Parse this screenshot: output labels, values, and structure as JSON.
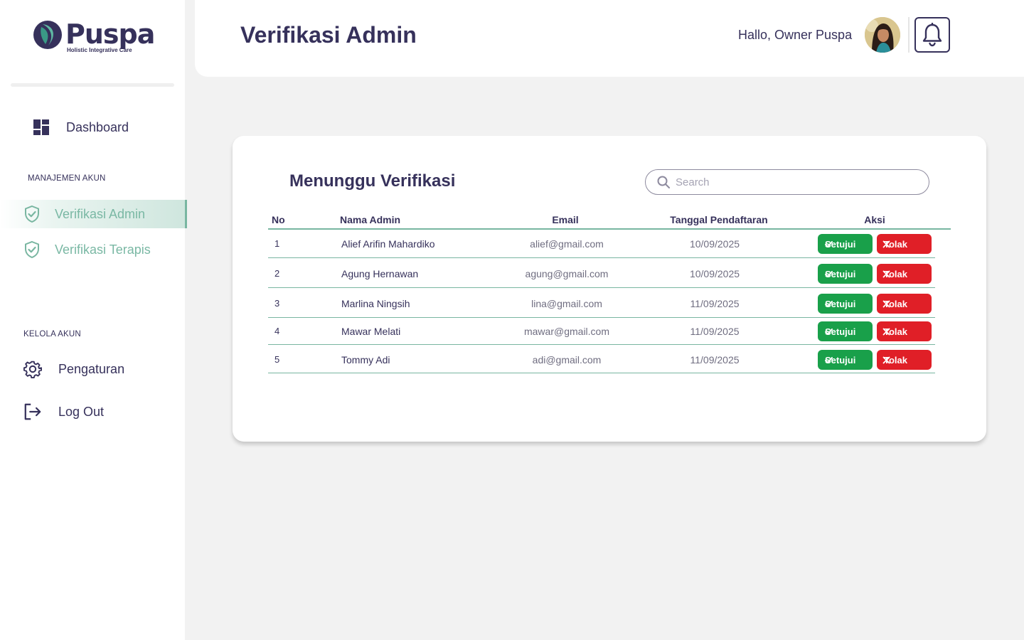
{
  "brand": {
    "name": "Puspa",
    "tagline": "Holistic Integrative Care",
    "primary_color": "#36315b",
    "accent_color": "#79b6a1"
  },
  "sidebar": {
    "dashboard_label": "Dashboard",
    "section_manage": "MANAJEMEN AKUN",
    "verif_admin_label": "Verifikasi Admin",
    "verif_terapis_label": "Verifikasi Terapis",
    "section_account": "KELOLA AKUN",
    "settings_label": "Pengaturan",
    "logout_label": "Log Out",
    "active_item": "Verifikasi Admin"
  },
  "header": {
    "title": "Verifikasi Admin",
    "greeting": "Hallo,  Owner Puspa"
  },
  "card": {
    "title": "Menunggu  Verifikasi",
    "search_placeholder": "Search"
  },
  "table": {
    "columns": [
      "No",
      "Nama  Admin",
      "Email",
      "Tanggal Pendaftaran",
      "Aksi"
    ],
    "approve_label": "Setujui",
    "reject_label": "Tolak",
    "approve_color": "#19a04a",
    "reject_color": "#e01f27",
    "rows": [
      {
        "no": "1",
        "name": "Alief Arifin Mahardiko",
        "email": "alief@gmail.com",
        "date": "10/09/2025"
      },
      {
        "no": "2",
        "name": "Agung Hernawan",
        "email": "agung@gmail.com",
        "date": "10/09/2025"
      },
      {
        "no": "3",
        "name": "Marlina Ningsih",
        "email": "lina@gmail.com",
        "date": "11/09/2025"
      },
      {
        "no": "4",
        "name": "Mawar Melati",
        "email": "mawar@gmail.com",
        "date": "11/09/2025"
      },
      {
        "no": "5",
        "name": "Tommy Adi",
        "email": "adi@gmail.com",
        "date": "11/09/2025"
      }
    ]
  },
  "icons": [
    "puspa-logo-icon",
    "dashboard-icon",
    "shield-check-icon",
    "gear-icon",
    "logout-icon",
    "avatar",
    "bell-icon",
    "search-icon",
    "check-icon",
    "close-icon"
  ]
}
